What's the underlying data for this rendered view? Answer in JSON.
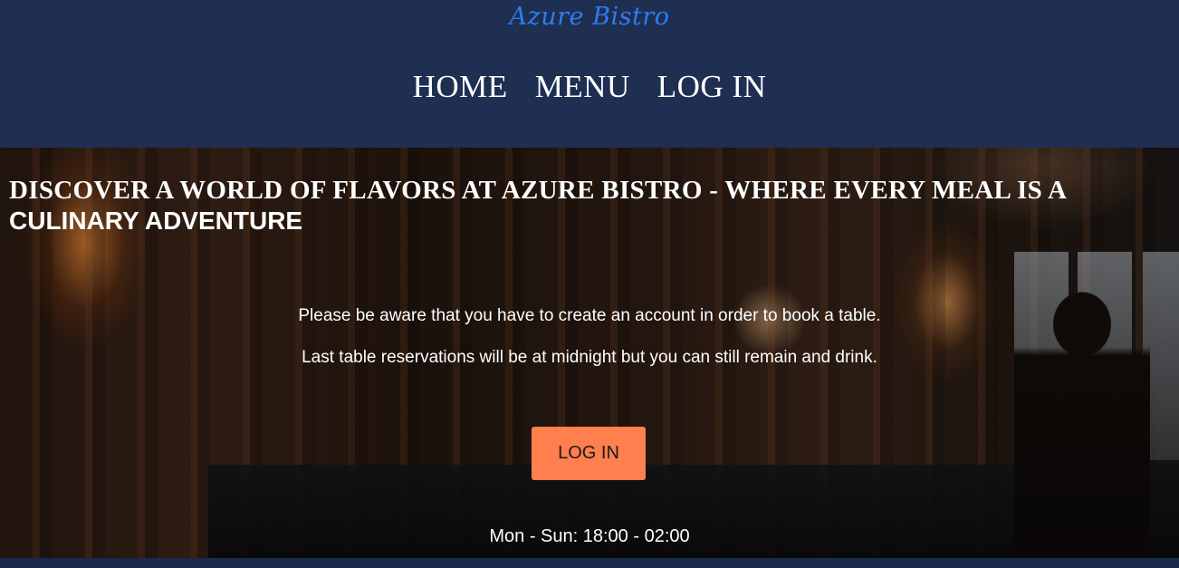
{
  "header": {
    "logo": "Azure Bistro",
    "nav": [
      {
        "label": "HOME"
      },
      {
        "label": "MENU"
      },
      {
        "label": "LOG IN"
      }
    ]
  },
  "hero": {
    "title_part1": "DISCOVER A WORLD OF FLAVORS AT AZURE BISTRO - WHERE EVERY MEAL IS A ",
    "title_part2": "CULINARY ADVENTURE",
    "notice_1": "Please be aware that you have to create an account in order to book a table.",
    "notice_2": "Last table reservations will be at midnight but you can still remain and drink.",
    "login_label": "LOG IN",
    "hours": "Mon - Sun: 18:00 - 02:00"
  },
  "colors": {
    "header_bg": "#1f2f52",
    "logo": "#2f7cf0",
    "button": "#ff7f4f"
  }
}
